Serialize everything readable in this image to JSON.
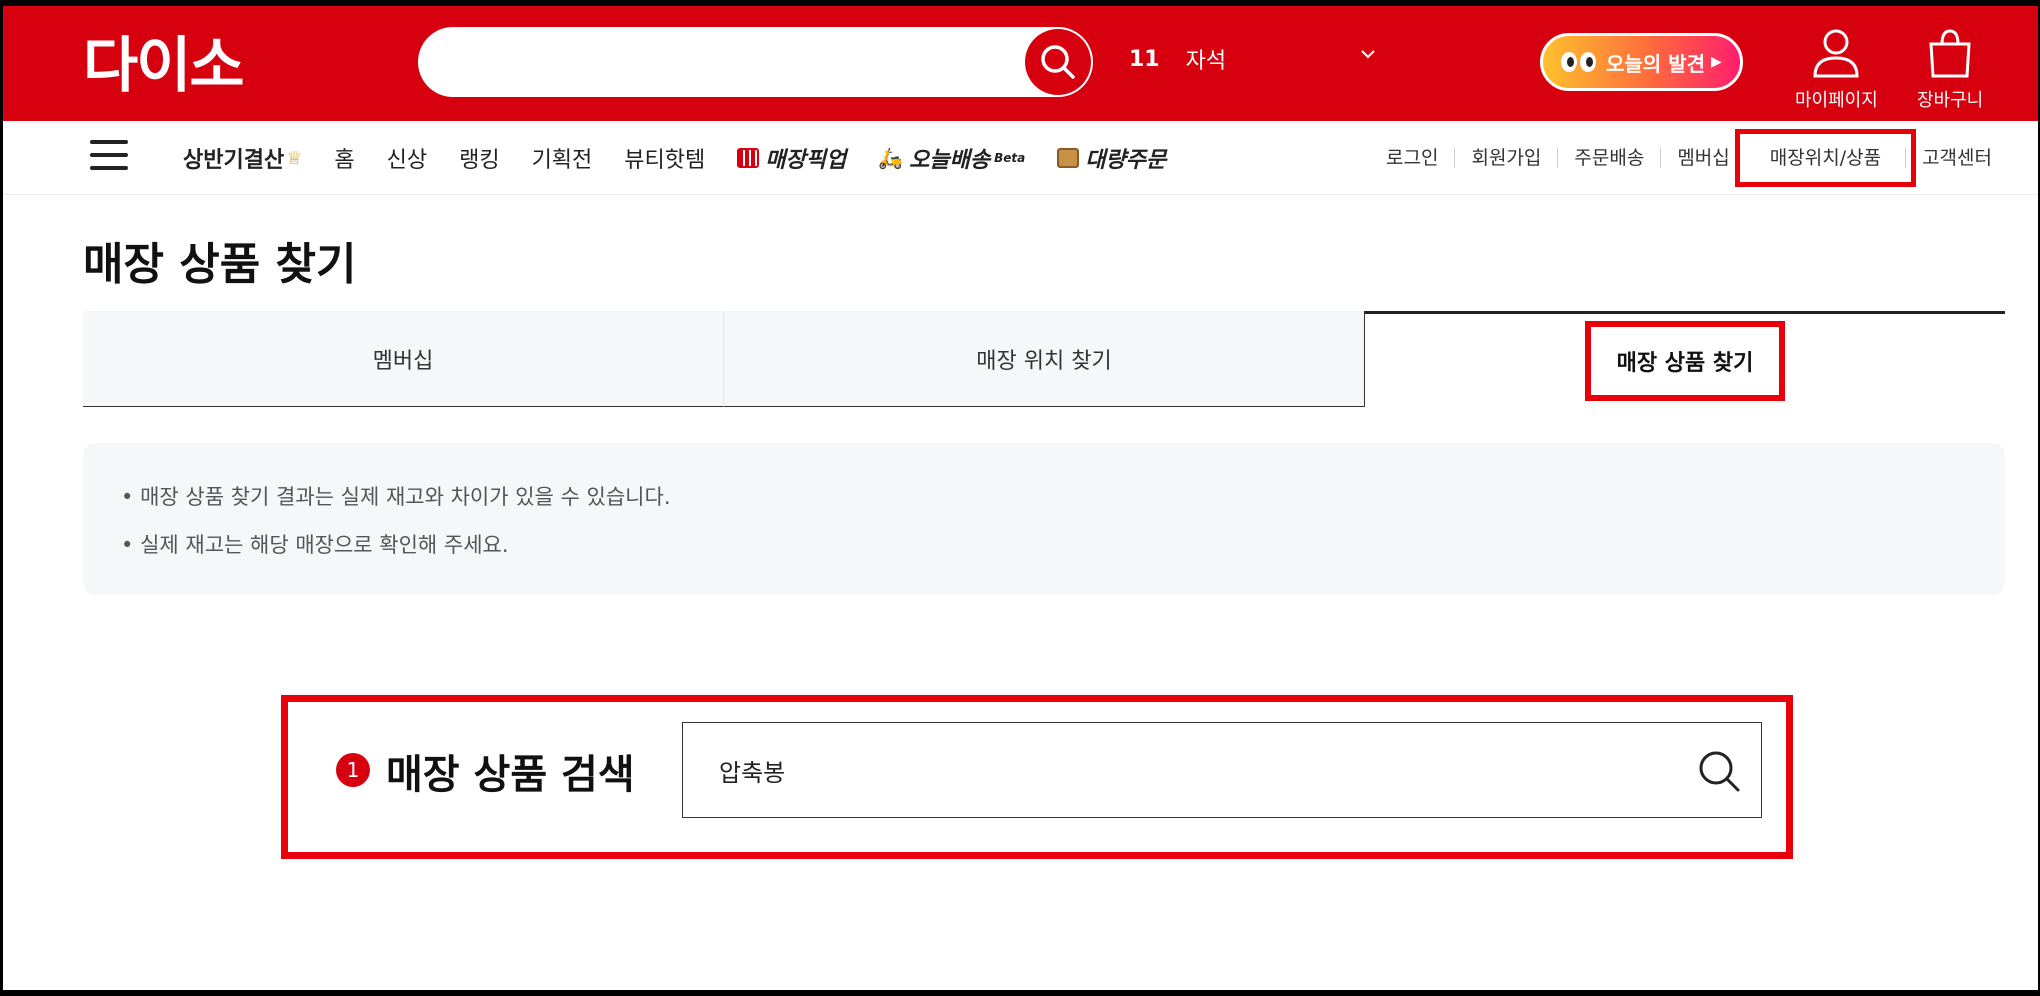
{
  "header": {
    "logo_text": "다이소",
    "search": {
      "value": "",
      "placeholder": ""
    },
    "rank": {
      "number": "11",
      "keyword": "자석"
    },
    "today_button": "오늘의 발견",
    "mypage_label": "마이페이지",
    "cart_label": "장바구니"
  },
  "nav": {
    "items": [
      {
        "label": "상반기결산"
      },
      {
        "label": "홈"
      },
      {
        "label": "신상"
      },
      {
        "label": "랭킹"
      },
      {
        "label": "기획전"
      },
      {
        "label": "뷰티핫템"
      },
      {
        "label": "매장픽업"
      },
      {
        "label": "오늘배송",
        "sup": "Beta"
      },
      {
        "label": "대량주문"
      }
    ],
    "util": [
      {
        "label": "로그인"
      },
      {
        "label": "회원가입"
      },
      {
        "label": "주문배송"
      },
      {
        "label": "멤버십"
      },
      {
        "label": "매장위치/상품"
      },
      {
        "label": "고객센터"
      }
    ]
  },
  "page": {
    "title": "매장 상품 찾기",
    "tabs": [
      {
        "label": "멤버십"
      },
      {
        "label": "매장 위치 찾기"
      },
      {
        "label": "매장 상품 찾기"
      }
    ],
    "notice": [
      "매장 상품 찾기 결과는 실제 재고와 차이가 있을 수 있습니다.",
      "실제 재고는 해당 매장으로 확인해 주세요."
    ],
    "product_search": {
      "step": "1",
      "label": "매장 상품 검색",
      "value": "압축봉"
    }
  },
  "colors": {
    "brand_red": "#d7000f",
    "highlight_red": "#e8000b"
  }
}
